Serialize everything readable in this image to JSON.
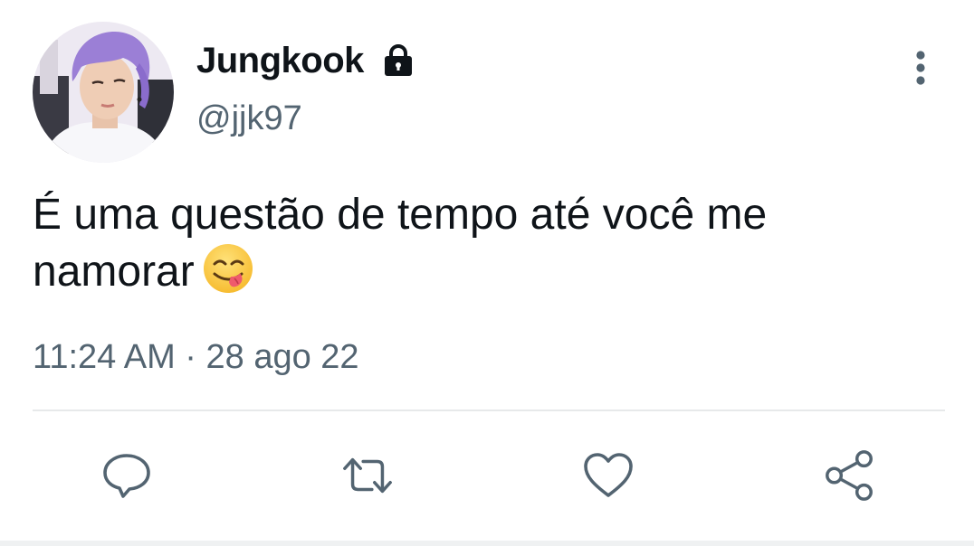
{
  "author": {
    "display_name": "Jungkook",
    "handle": "@jjk97",
    "protected_icon": "lock-icon",
    "avatar_hair_color": "#9b7fd6"
  },
  "tweet": {
    "text": "É uma questão de tempo até você me namorar",
    "emoji": "face-savoring-food-emoji",
    "time": "11:24 AM",
    "separator": "·",
    "date": "28 ago 22"
  },
  "actions": [
    {
      "name": "reply",
      "icon": "reply-icon"
    },
    {
      "name": "retweet",
      "icon": "retweet-icon"
    },
    {
      "name": "like",
      "icon": "heart-icon"
    },
    {
      "name": "share",
      "icon": "share-icon"
    }
  ],
  "colors": {
    "text": "#0f1419",
    "secondary": "#536471",
    "divider": "#e7e9ea"
  }
}
